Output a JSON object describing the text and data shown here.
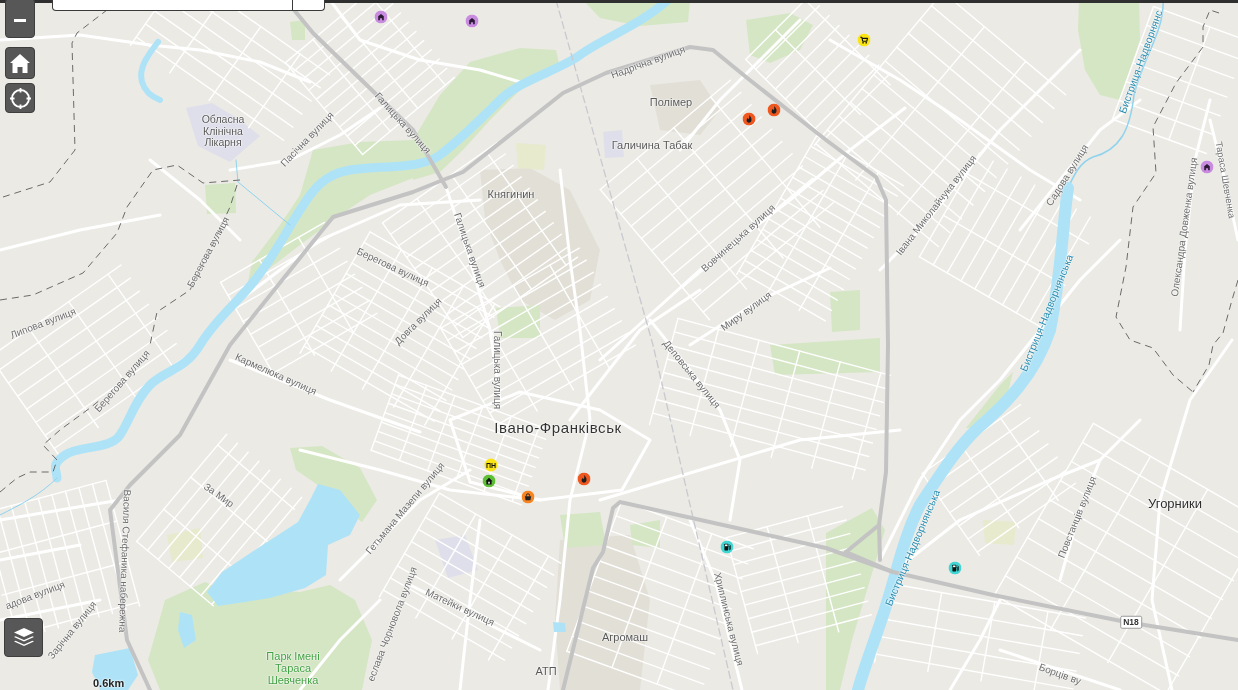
{
  "map": {
    "labels": [
      {
        "text": "Бистриця-Надворнянс",
        "kind": "river"
      },
      {
        "text": "Надрічна вулиця",
        "kind": "street"
      },
      {
        "text": "Полімер",
        "kind": "place"
      },
      {
        "text": "Обласна Клінічна Лікарня",
        "kind": "place"
      },
      {
        "text": "Галицька вулиця",
        "kind": "street"
      },
      {
        "text": "Пасічна вулиця",
        "kind": "street"
      },
      {
        "text": "Галичина Табак",
        "kind": "place"
      },
      {
        "text": "Садова вулиця",
        "kind": "street"
      },
      {
        "text": "Тараса Шевченка",
        "kind": "street"
      },
      {
        "text": "Княгинин",
        "kind": "place"
      },
      {
        "text": "Івана Миколайчука вулиця",
        "kind": "street"
      },
      {
        "text": "Олександра Довженка вулиця",
        "kind": "street"
      },
      {
        "text": "Вовчинецька вулиця",
        "kind": "street"
      },
      {
        "text": "Галицька вулиця",
        "kind": "street"
      },
      {
        "text": "Берегова вулиця",
        "kind": "street"
      },
      {
        "text": "Берегова вулиця",
        "kind": "street"
      },
      {
        "text": "Бистриця-Надворнянська",
        "kind": "river"
      },
      {
        "text": "Миру вулиця",
        "kind": "street"
      },
      {
        "text": "Довга вулиця",
        "kind": "street"
      },
      {
        "text": "Липова вулиця",
        "kind": "street"
      },
      {
        "text": "Галицька вулиця",
        "kind": "street"
      },
      {
        "text": "Деповська вулиця",
        "kind": "street"
      },
      {
        "text": "Кармелюка вулиця",
        "kind": "street"
      },
      {
        "text": "Берегова вулиця",
        "kind": "street"
      },
      {
        "text": "Івано-Франківськ",
        "kind": "city"
      },
      {
        "text": "За Мир",
        "kind": "street"
      },
      {
        "text": "Угорники",
        "kind": "district"
      },
      {
        "text": "Гетьмана Мазепи вулиця",
        "kind": "street"
      },
      {
        "text": "Повстанців вулиця",
        "kind": "street"
      },
      {
        "text": "Бистриця-Надворнянська",
        "kind": "river"
      },
      {
        "text": "Василя Стефаника набережна",
        "kind": "street"
      },
      {
        "text": "адова вулиця",
        "kind": "street"
      },
      {
        "text": "Матейки вулиця",
        "kind": "street"
      },
      {
        "text": "Хриплинська вулиця",
        "kind": "street"
      },
      {
        "text": "Зарічна вулиця",
        "kind": "street"
      },
      {
        "text": "еслава Чорновола вулиця",
        "kind": "street"
      },
      {
        "text": "Агромаш",
        "kind": "place"
      },
      {
        "text": "Парк Імені Тараса Шевченка",
        "kind": "park"
      },
      {
        "text": "АТП",
        "kind": "place"
      },
      {
        "text": "Борців ву",
        "kind": "street"
      }
    ],
    "markers": [
      {
        "kind": "building",
        "color": "#c98be0"
      },
      {
        "kind": "building",
        "color": "#c98be0"
      },
      {
        "kind": "cart",
        "color": "#fbe414"
      },
      {
        "kind": "flame",
        "color": "#f0571f"
      },
      {
        "kind": "flame",
        "color": "#f0571f"
      },
      {
        "kind": "building",
        "color": "#c98be0"
      },
      {
        "kind": "text",
        "text": "ПН",
        "color": "#fbe414"
      },
      {
        "kind": "house",
        "color": "#5cbf36"
      },
      {
        "kind": "flame",
        "color": "#f0571f"
      },
      {
        "kind": "bag",
        "color": "#f7841f"
      },
      {
        "kind": "fuel",
        "color": "#41d6d3"
      },
      {
        "kind": "fuel",
        "color": "#41d6d3"
      }
    ],
    "route_shield": {
      "text": "N18"
    }
  },
  "scale_bar": {
    "label": "0.6km"
  }
}
